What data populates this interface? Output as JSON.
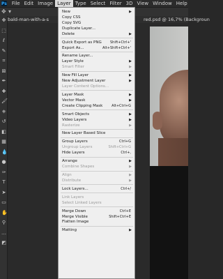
{
  "menubar": {
    "logo": "Ps",
    "items": [
      "File",
      "Edit",
      "Image",
      "Layer",
      "Type",
      "Select",
      "Filter",
      "3D",
      "View",
      "Window",
      "Help"
    ],
    "active_index": 3
  },
  "tab": {
    "title": "bald-man-with-a-s",
    "title_right": "red.psd @ 16,7% (Backgroun"
  },
  "layer_menu": {
    "items": [
      {
        "label": "New",
        "arrow": true,
        "disabled": false
      },
      {
        "label": "Copy CSS",
        "disabled": false
      },
      {
        "label": "Copy SVG",
        "disabled": false
      },
      {
        "label": "Duplicate Layer...",
        "disabled": false
      },
      {
        "label": "Delete",
        "arrow": true,
        "disabled": false
      },
      {
        "sep": true
      },
      {
        "label": "Quick Export as PNG",
        "shortcut": "Shift+Ctrl+'",
        "disabled": false
      },
      {
        "label": "Export As...",
        "shortcut": "Alt+Shift+Ctrl+'",
        "disabled": false
      },
      {
        "sep": true
      },
      {
        "label": "Rename Layer...",
        "disabled": false
      },
      {
        "label": "Layer Style",
        "arrow": true,
        "disabled": false
      },
      {
        "label": "Smart Filter",
        "arrow": true,
        "disabled": true
      },
      {
        "sep": true
      },
      {
        "label": "New Fill Layer",
        "arrow": true,
        "disabled": false
      },
      {
        "label": "New Adjustment Layer",
        "arrow": true,
        "disabled": false
      },
      {
        "label": "Layer Content Options...",
        "disabled": true
      },
      {
        "sep": true
      },
      {
        "label": "Layer Mask",
        "arrow": true,
        "disabled": false
      },
      {
        "label": "Vector Mask",
        "arrow": true,
        "disabled": false
      },
      {
        "label": "Create Clipping Mask",
        "shortcut": "Alt+Ctrl+G",
        "disabled": false
      },
      {
        "sep": true
      },
      {
        "label": "Smart Objects",
        "arrow": true,
        "disabled": false
      },
      {
        "label": "Video Layers",
        "arrow": true,
        "disabled": false
      },
      {
        "label": "Rasterize",
        "arrow": true,
        "disabled": true
      },
      {
        "sep": true
      },
      {
        "label": "New Layer Based Slice",
        "disabled": false
      },
      {
        "sep": true
      },
      {
        "label": "Group Layers",
        "shortcut": "Ctrl+G",
        "disabled": false
      },
      {
        "label": "Ungroup Layers",
        "shortcut": "Shift+Ctrl+G",
        "disabled": true
      },
      {
        "label": "Hide Layers",
        "shortcut": "Ctrl+,",
        "disabled": false
      },
      {
        "sep": true
      },
      {
        "label": "Arrange",
        "arrow": true,
        "disabled": false
      },
      {
        "label": "Combine Shapes",
        "arrow": true,
        "disabled": true
      },
      {
        "sep": true
      },
      {
        "label": "Align",
        "arrow": true,
        "disabled": true
      },
      {
        "label": "Distribute",
        "arrow": true,
        "disabled": true
      },
      {
        "sep": true
      },
      {
        "label": "Lock Layers...",
        "shortcut": "Ctrl+/",
        "disabled": false
      },
      {
        "sep": true
      },
      {
        "label": "Link Layers",
        "disabled": true
      },
      {
        "label": "Select Linked Layers",
        "disabled": true
      },
      {
        "sep": true
      },
      {
        "label": "Merge Down",
        "shortcut": "Ctrl+E",
        "disabled": false
      },
      {
        "label": "Merge Visible",
        "shortcut": "Shift+Ctrl+E",
        "disabled": false
      },
      {
        "label": "Flatten Image",
        "disabled": false
      },
      {
        "sep": true
      },
      {
        "label": "Matting",
        "arrow": true,
        "disabled": false
      }
    ]
  },
  "icons": [
    "move-icon",
    "marquee-icon",
    "lasso-icon",
    "quick-select-icon",
    "crop-icon",
    "frame-icon",
    "eyedropper-icon",
    "healing-icon",
    "brush-icon",
    "stamp-icon",
    "history-brush-icon",
    "eraser-icon",
    "gradient-icon",
    "blur-icon",
    "dodge-icon",
    "pen-icon",
    "type-icon",
    "path-select-icon",
    "shape-icon",
    "hand-icon",
    "zoom-icon",
    "more-icon",
    "colors-icon"
  ]
}
